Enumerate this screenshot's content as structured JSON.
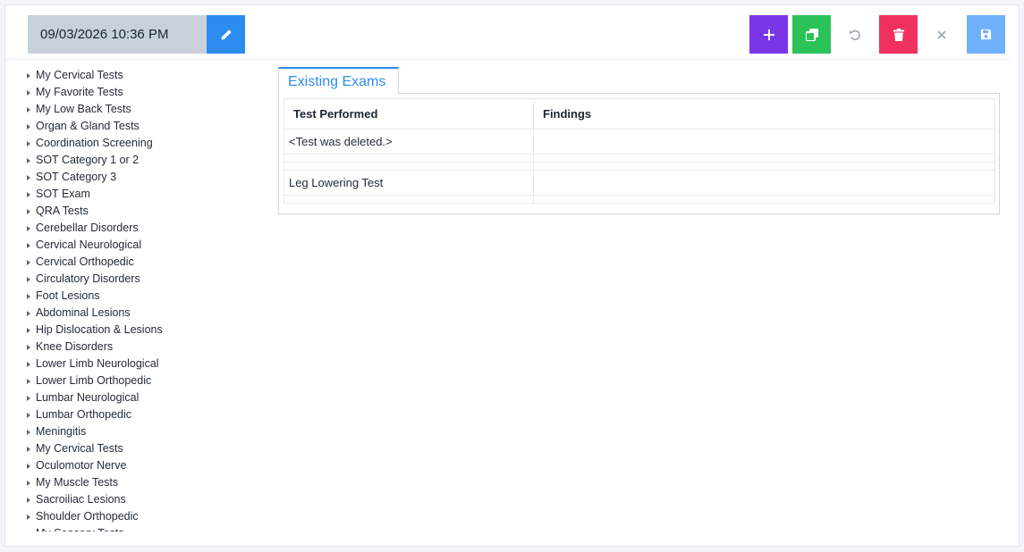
{
  "header": {
    "datetime": "09/03/2026 10:36 PM",
    "buttons": [
      {
        "name": "edit-button",
        "icon": "pencil-icon",
        "color": "#2d8cf0"
      },
      {
        "name": "add-button",
        "icon": "plus-icon",
        "color": "#7b35e9"
      },
      {
        "name": "duplicate-button",
        "icon": "copy-icon",
        "color": "#2bc25a"
      },
      {
        "name": "undo-button",
        "icon": "undo-icon",
        "color": "transparent"
      },
      {
        "name": "delete-button",
        "icon": "trash-icon",
        "color": "#f0315f"
      },
      {
        "name": "close-button",
        "icon": "close-icon",
        "color": "transparent"
      },
      {
        "name": "save-button",
        "icon": "save-icon",
        "color": "#6fb1fa"
      }
    ]
  },
  "tree": {
    "items": [
      "My Cervical Tests",
      "My Favorite Tests",
      "My Low Back Tests",
      "Organ & Gland Tests",
      "Coordination Screening",
      "SOT Category 1 or 2",
      "SOT Category 3",
      "SOT Exam",
      "QRA Tests",
      "Cerebellar Disorders",
      "Cervical Neurological",
      "Cervical Orthopedic",
      "Circulatory Disorders",
      "Foot Lesions",
      "Abdominal Lesions",
      "Hip Dislocation & Lesions",
      "Knee Disorders",
      "Lower Limb Neurological",
      "Lower Limb Orthopedic",
      "Lumbar Neurological",
      "Lumbar Orthopedic",
      "Meningitis",
      "My Cervical Tests",
      "Oculomotor Nerve",
      "My Muscle Tests",
      "Sacroiliac Lesions",
      "Shoulder Orthopedic",
      "My Sensory Tests"
    ]
  },
  "exams": {
    "tab_label": "Existing Exams",
    "columns": [
      "Test Performed",
      "Findings"
    ],
    "rows": [
      {
        "test": "<Test was deleted.>",
        "findings": "",
        "size": "tall"
      },
      {
        "test": "",
        "findings": "",
        "size": "short"
      },
      {
        "test": "",
        "findings": "",
        "size": "short"
      },
      {
        "test": "Leg Lowering Test",
        "findings": "",
        "size": "tall"
      },
      {
        "test": "",
        "findings": "",
        "size": "short"
      }
    ]
  }
}
